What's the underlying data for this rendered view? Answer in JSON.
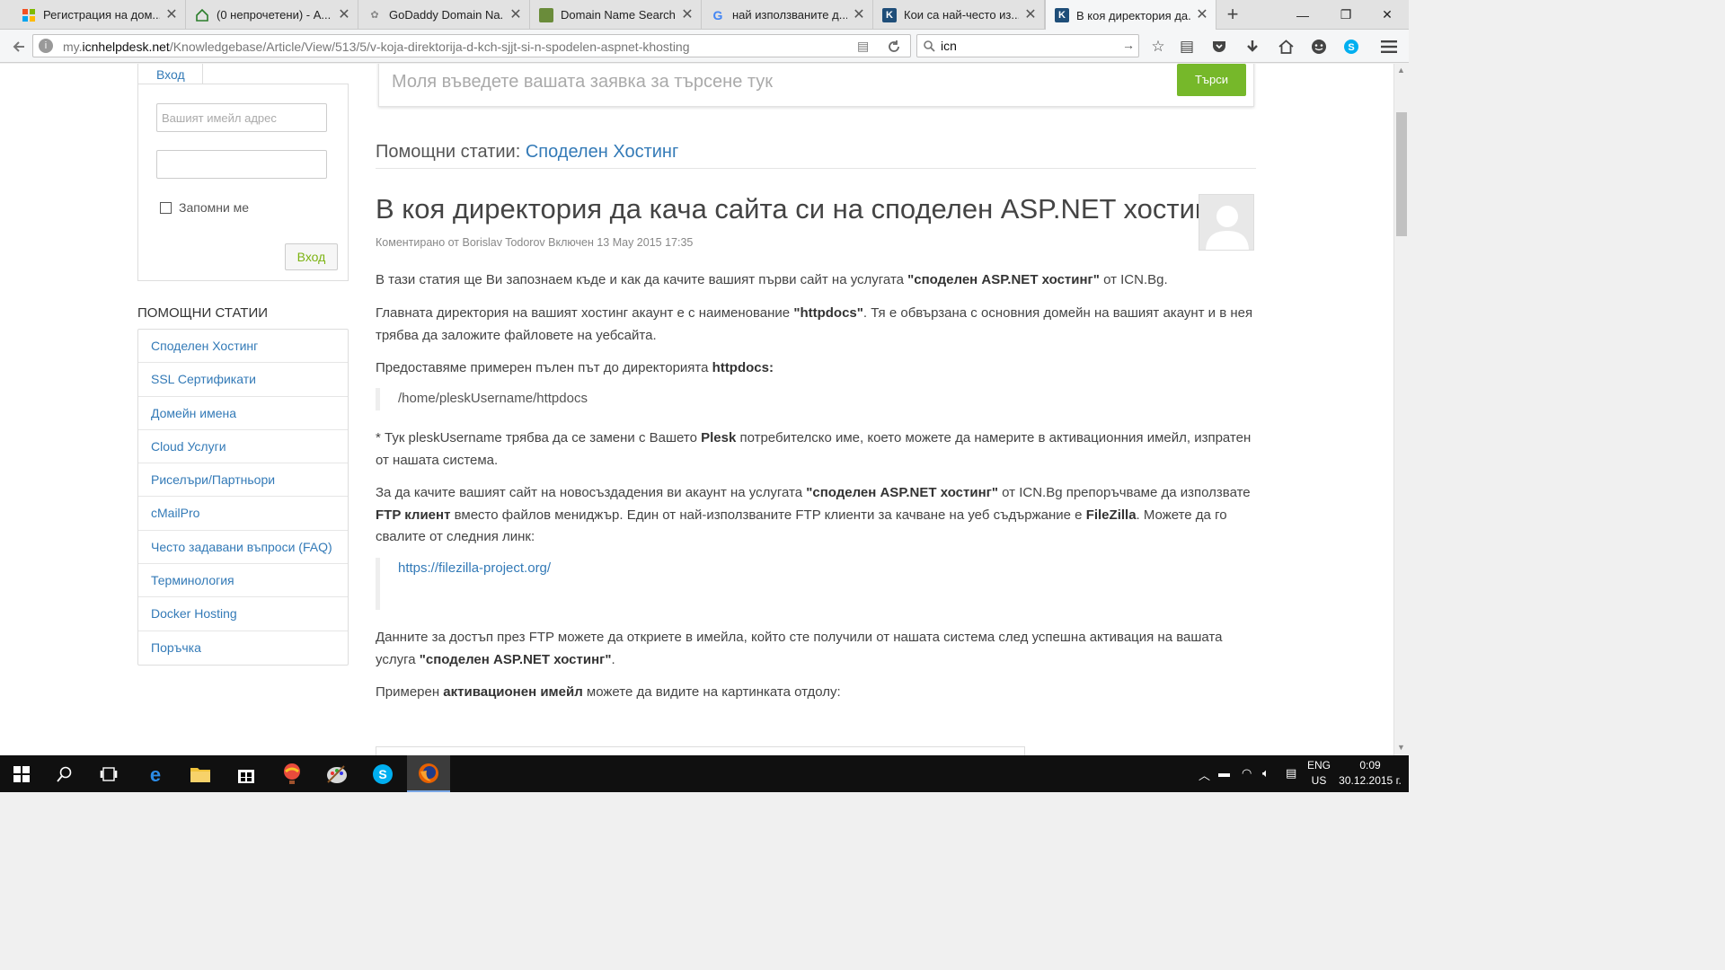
{
  "browser": {
    "tabs": [
      {
        "title": "Регистрация на дом...",
        "favicon": "office-icon",
        "color": "#d83b01"
      },
      {
        "title": "(0 непрочетени) - А...",
        "favicon": "home-icon",
        "color": "#2a7d2a"
      },
      {
        "title": "GoDaddy Domain Na...",
        "favicon": "godaddy-icon",
        "color": "#7a7a7a"
      },
      {
        "title": "Domain Name Search...",
        "favicon": "domain-icon",
        "color": "#6a8c3a"
      },
      {
        "title": "най използваните д...",
        "favicon": "google-icon",
        "color": "#4285f4"
      },
      {
        "title": "Кои са най-често из...",
        "favicon": "k-icon",
        "color": "#1f4e79"
      },
      {
        "title": "В коя директория да...",
        "favicon": "k-icon",
        "color": "#1f4e79"
      }
    ],
    "url_prefix": "my.",
    "url_domain": "icnhelpdesk.net",
    "url_path": "/Knowledgebase/Article/View/513/5/v-koja-direktorija-d-kch-sjjt-si-n-spodelen-aspnet-khosting",
    "search_value": "icn"
  },
  "login": {
    "tab_label": "Вход",
    "email_placeholder": "Вашият имейл адрес",
    "remember_label": "Запомни ме",
    "submit_label": "Вход"
  },
  "sidebar": {
    "heading": "ПОМОЩНИ СТАТИИ",
    "items": [
      {
        "label": "Споделен Хостинг"
      },
      {
        "label": "SSL Сертификати"
      },
      {
        "label": "Домейн имена"
      },
      {
        "label": "Cloud Услуги"
      },
      {
        "label": "Риселъри/Партньори"
      },
      {
        "label": "cMailPro"
      },
      {
        "label": "Често задавани въпроси (FAQ)"
      },
      {
        "label": "Терминология"
      },
      {
        "label": "Docker Hosting"
      },
      {
        "label": "Поръчка"
      }
    ]
  },
  "search": {
    "placeholder": "Моля въведете вашата заявка за търсене тук",
    "button": "Търси"
  },
  "breadcrumb": {
    "prefix": "Помощни статии:",
    "category": "Споделен Хостинг"
  },
  "article": {
    "title": "В коя директория да кача сайта си на споделен ASP.NET хостинг ?",
    "meta": "Коментирано от Borislav Todorov Включен 13 May 2015 17:35",
    "p1_a": "В тази статия ще Ви запознаем къде и как да качите вашият първи сайт на услугата ",
    "p1_b": "\"споделен ASP.NET хостинг\"",
    "p1_c": " от ICN.Bg.",
    "p2_a": "Главната директория на вашият хостинг акаунт е с наименование ",
    "p2_b": "\"httpdocs\"",
    "p2_c": ". Тя е обвързана с основния домейн на вашият акаунт и в нея трябва да заложите файловете на уебсайта.",
    "p3_a": "Предоставяме примерен пълен път до директорията ",
    "p3_b": "httpdocs:",
    "path": "/home/pleskUsername/httpdocs",
    "p4_a": "* Тук pleskUsername трябва да се замени с Вашето ",
    "p4_b": "Plesk",
    "p4_c": " потребителско име, което можете да намерите в активационния имейл, изпратен от нашата система.",
    "p5_a": "За да качите вашият сайт на новосъздадения ви акаунт на услугата ",
    "p5_b": "\"споделен ASP.NET хостинг\"",
    "p5_c": " от ICN.Bg препоръчваме да използвате ",
    "p5_d": "FTP клиент",
    "p5_e": " вместо файлов мениджър. Един от най-използваните FTP клиенти за качване на уеб съдържание е ",
    "p5_f": "FileZilla",
    "p5_g": ". Можете да го свалите от следния линк:",
    "link": "https://filezilla-project.org/",
    "p6_a": "Данните за достъп през FTP можете да откриете в имейла, който сте получили от нашата система след успешна активация на вашата услуга ",
    "p6_b": "\"споделен ASP.NET хостинг\"",
    "p6_c": ".",
    "p7_a": "Примерен ",
    "p7_b": "активационен имейл",
    "p7_c": " можете да видите на картинката отдолу:"
  },
  "taskbar": {
    "lang_top": "ENG",
    "lang_bottom": "US",
    "time": "0:09",
    "date": "30.12.2015 г."
  }
}
